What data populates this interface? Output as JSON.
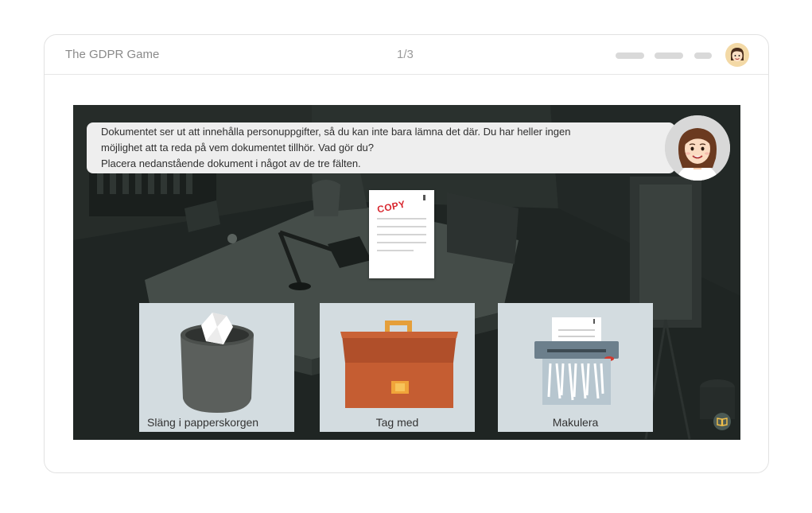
{
  "app": {
    "title": "The GDPR Game",
    "page_indicator": "1/3"
  },
  "dialog": {
    "line1": "Dokumentet ser ut att innehålla personuppgifter, så du kan inte bara lämna det där. Du har heller ingen",
    "line2": "möjlighet att ta reda på vem dokumentet tillhör. Vad gör du?",
    "line3": "Placera nedanstående dokument i något av de tre fälten."
  },
  "document": {
    "stamp": "COPY"
  },
  "options": [
    {
      "label": "Släng i papperskorgen",
      "icon": "trash-bin-icon"
    },
    {
      "label": "Tag med",
      "icon": "briefcase-icon"
    },
    {
      "label": "Makulera",
      "icon": "paper-shredder-icon"
    }
  ],
  "colors": {
    "stage_bg": "#1e2422",
    "option_bg": "#d3dce0",
    "briefcase": "#c0572f",
    "stamp": "#d8262e"
  }
}
